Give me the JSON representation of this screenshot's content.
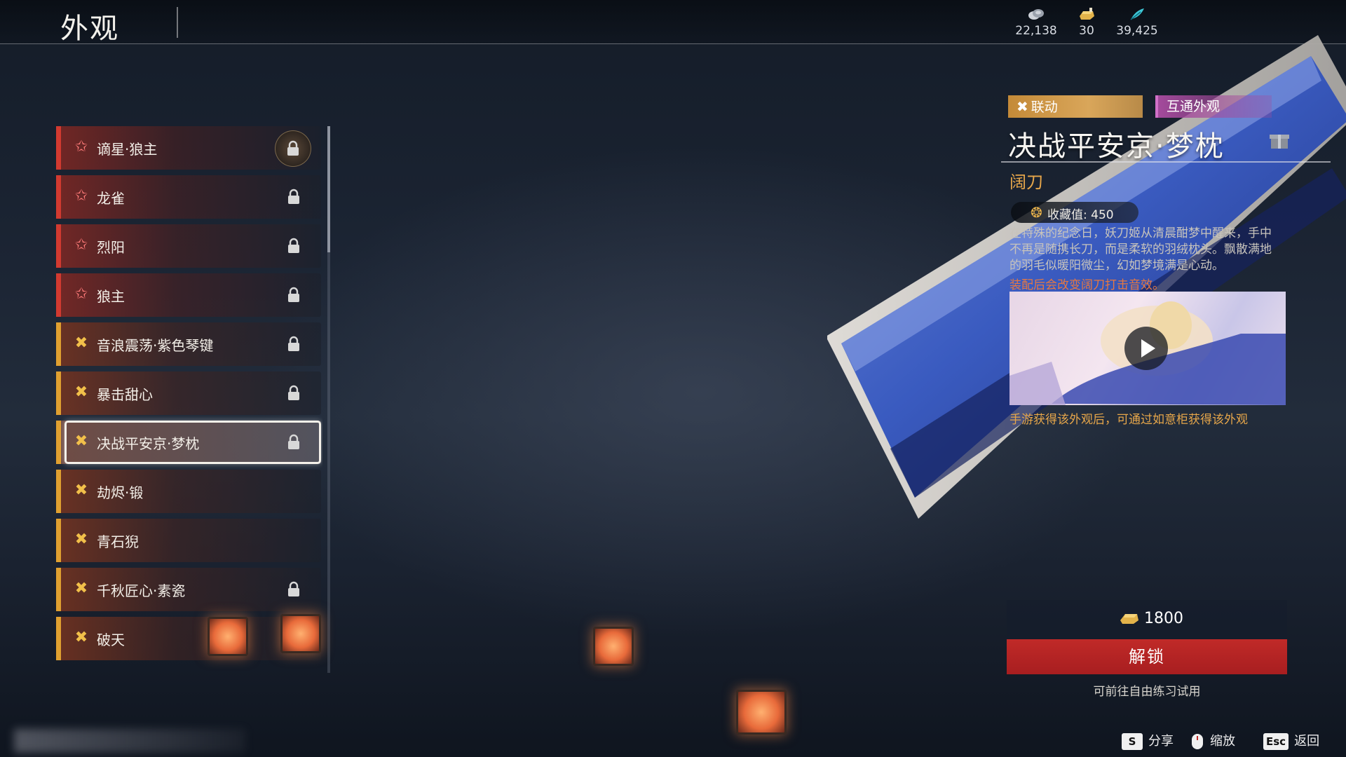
{
  "header": {
    "title": "外观"
  },
  "currencies": [
    {
      "icon": "coin-stack-icon",
      "value": "22,138"
    },
    {
      "icon": "gold-ingot-icon",
      "value": "30"
    },
    {
      "icon": "feather-icon",
      "value": "39,425"
    }
  ],
  "list": {
    "items": [
      {
        "label": "谪星·狼主",
        "rarity": "red",
        "locked": true
      },
      {
        "label": "龙雀",
        "rarity": "red",
        "locked": true
      },
      {
        "label": "烈阳",
        "rarity": "red",
        "locked": true
      },
      {
        "label": "狼主",
        "rarity": "red",
        "locked": true
      },
      {
        "label": "音浪震荡·紫色琴键",
        "rarity": "gold",
        "locked": true
      },
      {
        "label": "暴击甜心",
        "rarity": "gold",
        "locked": true
      },
      {
        "label": "决战平安京·梦枕",
        "rarity": "gold",
        "locked": true
      },
      {
        "label": "劫烬·锻",
        "rarity": "gold",
        "locked": false
      },
      {
        "label": "青石猊",
        "rarity": "gold",
        "locked": false
      },
      {
        "label": "千秋匠心·素瓷",
        "rarity": "gold",
        "locked": true
      },
      {
        "label": "破天",
        "rarity": "gold",
        "locked": false
      }
    ],
    "selected_index": 6
  },
  "detail": {
    "tag_collab": "联动",
    "tag_shared": "互通外观",
    "title": "决战平安京·梦枕",
    "weapon": "阔刀",
    "collection_label": "收藏值: 450",
    "description_line1": "在特殊的纪念日，妖刀姬从清晨酣梦中醒来，手中",
    "description_line2": "不再是随携长刀，而是柔软的羽绒枕头。飘散满地",
    "description_line3": "的羽毛似暖阳微尘，幻如梦境满是心动。",
    "description_note": "装配后会改变阔刀打击音效。",
    "obtain_note": "手游获得该外观后，可通过如意柜获得该外观",
    "price": "1800",
    "unlock_label": "解锁",
    "trial_hint": "可前往自由练习试用"
  },
  "footer": {
    "share_key": "S",
    "share_label": "分享",
    "zoom_label": "缩放",
    "back_key": "Esc",
    "back_label": "返回"
  }
}
